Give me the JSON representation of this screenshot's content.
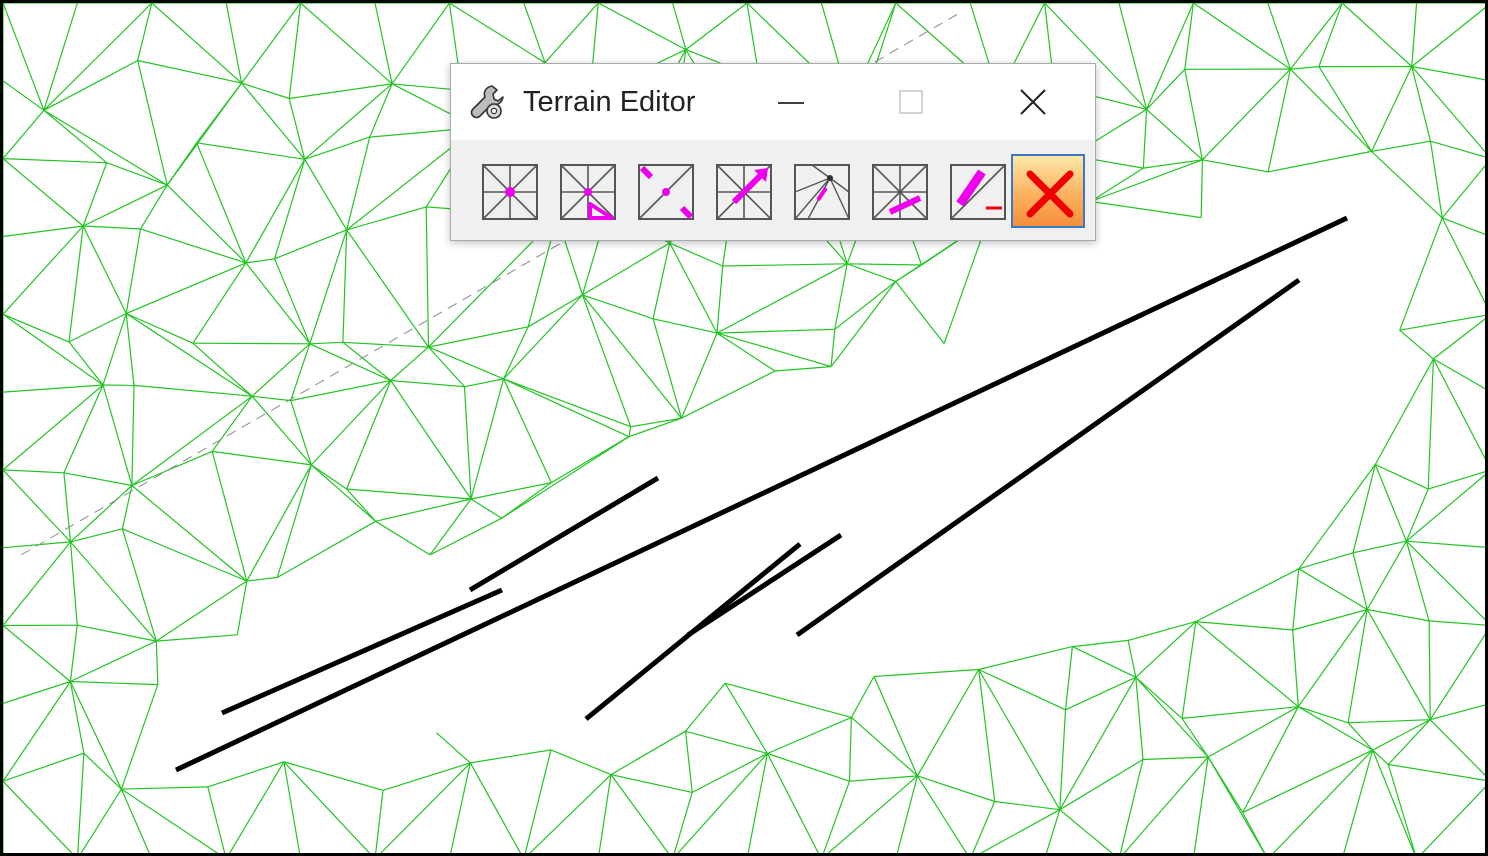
{
  "window": {
    "title": "Terrain Editor",
    "app_icon": "wrench-gear-icon",
    "buttons": {
      "minimize": "minimize-icon",
      "maximize": "maximize-icon",
      "close": "close-icon"
    }
  },
  "toolbar": {
    "tools": [
      {
        "name": "insert-vertex-tool",
        "icon": "mesh-point-icon",
        "active": false
      },
      {
        "name": "delete-vertex-tool",
        "icon": "mesh-triangle-icon",
        "active": false
      },
      {
        "name": "move-vertex-tool",
        "icon": "mesh-move-icon",
        "active": false
      },
      {
        "name": "flip-edge-tool",
        "icon": "mesh-arrow-icon",
        "active": false
      },
      {
        "name": "swap-triangle-tool",
        "icon": "mesh-fan-icon",
        "active": false
      },
      {
        "name": "delete-edge-tool",
        "icon": "mesh-edge-icon",
        "active": false
      },
      {
        "name": "edit-line-tool",
        "icon": "mesh-pencil-icon",
        "active": false
      },
      {
        "name": "cancel-tool",
        "icon": "red-x-icon",
        "active": true
      }
    ]
  },
  "colors": {
    "mesh": "#22c422",
    "breakline": "#000000",
    "dashed": "#8a8a8a",
    "tool_accent": "#ee00ee",
    "cancel_x": "#ee0000",
    "active_border": "#3a78c8"
  }
}
